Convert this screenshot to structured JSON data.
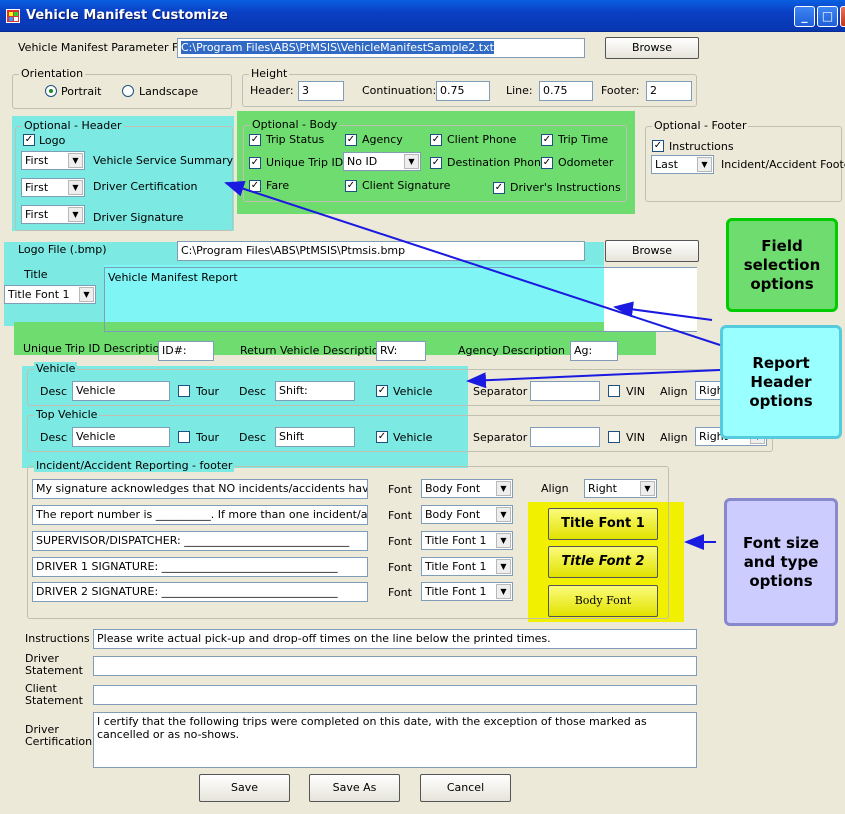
{
  "window": {
    "title": "Vehicle Manifest Customize"
  },
  "param_file": {
    "label": "Vehicle Manifest Parameter File",
    "value": "C:\\Program Files\\ABS\\PtMSIS\\VehicleManifestSample2.txt",
    "browse": "Browse"
  },
  "orientation": {
    "title": "Orientation",
    "portrait": "Portrait",
    "landscape": "Landscape"
  },
  "height": {
    "title": "Height",
    "header_label": "Header:",
    "header": "3",
    "continuation_label": "Continuation:",
    "continuation": "0.75",
    "line_label": "Line:",
    "line": "0.75",
    "footer_label": "Footer:",
    "footer": "2"
  },
  "opt_header": {
    "title": "Optional - Header",
    "logo": "Logo",
    "rows": [
      {
        "sel": "First",
        "label": "Vehicle Service Summary"
      },
      {
        "sel": "First",
        "label": "Driver Certification"
      },
      {
        "sel": "First",
        "label": "Driver Signature"
      }
    ]
  },
  "opt_body": {
    "title": "Optional - Body",
    "trip_status": "Trip Status",
    "agency": "Agency",
    "client_phone": "Client Phone",
    "trip_time": "Trip Time",
    "unique_trip_id": "Unique Trip ID",
    "no_id": "No ID",
    "destination_phone": "Destination Phone",
    "odometer": "Odometer",
    "fare": "Fare",
    "client_signature": "Client Signature",
    "drivers_instructions": "Driver's Instructions"
  },
  "opt_footer": {
    "title": "Optional - Footer",
    "instructions": "Instructions",
    "sel": "Last",
    "label": "Incident/Accident Footer"
  },
  "logo_file": {
    "label": "Logo File (.bmp)",
    "value": "C:\\Program Files\\ABS\\PtMSIS\\Ptmsis.bmp",
    "browse": "Browse"
  },
  "title_section": {
    "label": "Title",
    "font": "Title Font 1",
    "text": "Vehicle Manifest Report"
  },
  "descriptions": {
    "unique_label": "Unique Trip ID Description",
    "unique": "ID#:",
    "return_label": "Return Vehicle Description",
    "return": "RV:",
    "agency_label": "Agency Description",
    "agency": "Ag:"
  },
  "vehicle": {
    "title": "Vehicle",
    "desc_label": "Desc",
    "desc": "Vehicle",
    "tour": "Tour",
    "desc2_label": "Desc",
    "desc2": "Shift:",
    "vehicle_label": "Vehicle",
    "separator_label": "Separator",
    "separator": "",
    "vin": "VIN",
    "align_label": "Align",
    "align": "Right"
  },
  "top_vehicle": {
    "title": "Top Vehicle",
    "desc_label": "Desc",
    "desc": "Vehicle",
    "tour": "Tour",
    "desc2_label": "Desc",
    "desc2": "Shift",
    "vehicle_label": "Vehicle",
    "separator_label": "Separator",
    "separator": "",
    "vin": "VIN",
    "align_label": "Align",
    "align": "Right"
  },
  "incident": {
    "title": "Incident/Accident Reporting - footer",
    "font_label": "Font",
    "align_label": "Align",
    "align": "Right",
    "lines": [
      {
        "text": "My signature acknowledges that NO incidents/accidents have gone u",
        "font": "Body Font"
      },
      {
        "text": "The report number is __________. If more than one incident/accident",
        "font": "Body Font"
      },
      {
        "text": "SUPERVISOR/DISPATCHER: ______________________________",
        "font": "Title Font 1"
      },
      {
        "text": "DRIVER 1 SIGNATURE: ________________________________",
        "font": "Title Font 1"
      },
      {
        "text": "DRIVER 2 SIGNATURE: ________________________________",
        "font": "Title Font 1"
      }
    ]
  },
  "font_buttons": {
    "title1": "Title Font 1",
    "title2": "Title Font 2",
    "body": "Body Font"
  },
  "statements": {
    "instructions_label": "Instructions",
    "instructions": "Please write actual pick-up and drop-off times on the line below the printed times.",
    "driver_label": "Driver Statement",
    "driver": "",
    "client_label": "Client Statement",
    "client": "",
    "cert_label": "Driver Certification",
    "cert": "I certify that the following trips were completed on this date, with the exception of those marked as cancelled or as no-shows."
  },
  "buttons": {
    "save": "Save",
    "save_as": "Save As",
    "cancel": "Cancel"
  },
  "callouts": {
    "field": "Field selection options",
    "report": "Report Header options",
    "font": "Font size and type options"
  },
  "colors": {
    "cyan_highlight": "#73f0f0",
    "green_highlight": "#5ad85a",
    "yellow_highlight": "#f0f000",
    "titlebar": "#0a46d0"
  }
}
